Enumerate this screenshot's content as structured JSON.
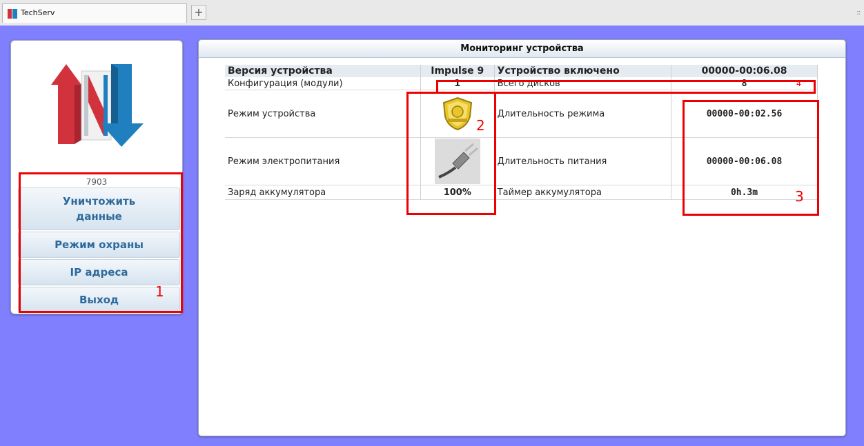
{
  "browser": {
    "tab_title": "TechServ",
    "new_tab_symbol": "+",
    "menu_grip": "::"
  },
  "sidebar": {
    "logo": "techserv-logo",
    "device_id": "7903",
    "buttons": [
      {
        "label": "Уничтожить данные"
      },
      {
        "label": "Режим охраны"
      },
      {
        "label": "IP адреса"
      },
      {
        "label": "Выход"
      }
    ]
  },
  "main": {
    "title": "Мониторинг устройства",
    "rows": [
      {
        "label": "Версия устройства",
        "value": "Impulse 9",
        "label2": "Устройство включено",
        "value2": "00000-00:06.08"
      },
      {
        "label": "Конфигурация (модули)",
        "value": "1",
        "label2": "Всего дисков",
        "value2": "8"
      },
      {
        "label": "Режим устройства",
        "icon": "protection-shield-icon",
        "label2": "Длительность режима",
        "value2": "00000-00:02.56"
      },
      {
        "label": "Режим электропитания",
        "icon": "power-plug-icon",
        "label2": "Длительность питания",
        "value2": "00000-00:06.08"
      },
      {
        "label": "Заряд аккумулятора",
        "value": "100%",
        "label2": "Таймер аккумулятора",
        "value2": "0h.3m"
      }
    ]
  },
  "annotations": {
    "n1": "1",
    "n2": "2",
    "n3": "3",
    "n4": "4",
    "color": "#ee0000"
  },
  "colors": {
    "page_background": "#8080ff",
    "button_text": "#2d6a9c",
    "logo_red": "#d2323c",
    "logo_blue": "#1f7fbf"
  }
}
